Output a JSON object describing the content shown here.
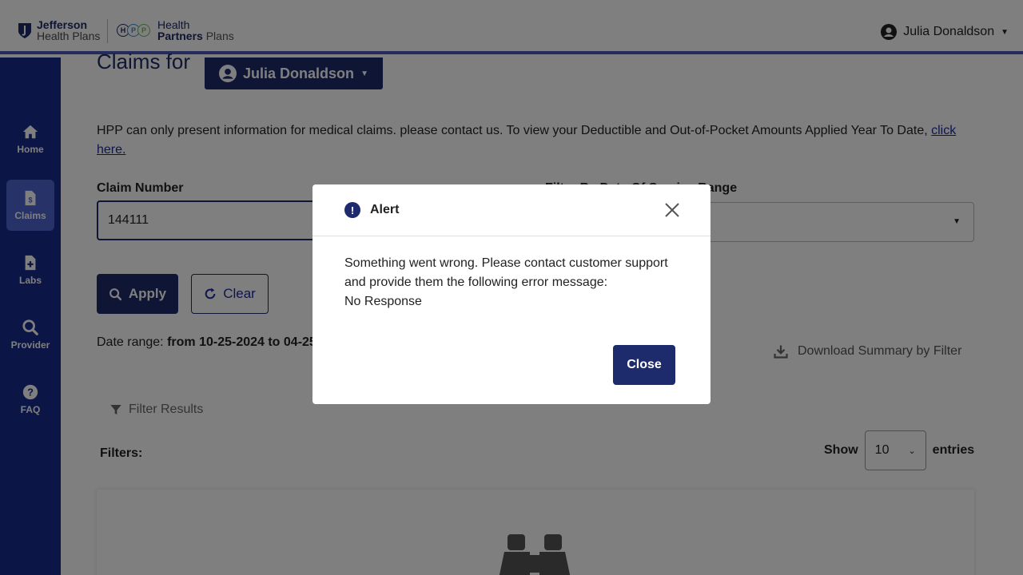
{
  "header": {
    "brand1_line1": "Jefferson",
    "brand1_line2": "Health Plans",
    "brand2_line1": "Health",
    "brand2_line2a": "Partners",
    "brand2_line2b": "Plans",
    "user_name": "Julia Donaldson"
  },
  "sidebar": {
    "items": [
      {
        "label": "Home",
        "icon": "home-icon"
      },
      {
        "label": "Claims",
        "icon": "claims-icon"
      },
      {
        "label": "Labs",
        "icon": "labs-icon"
      },
      {
        "label": "Provider",
        "icon": "search-icon"
      },
      {
        "label": "FAQ",
        "icon": "question-icon"
      }
    ]
  },
  "main": {
    "title": "Claims for",
    "member": "Julia Donaldson",
    "info_text": "HPP can only present information for medical claims. please contact us. To view your Deductible and Out-of-Pocket Amounts Applied Year To Date,",
    "info_link": "click here.",
    "claim_label": "Claim Number",
    "claim_value": "144111",
    "date_label": "Filter By Date Of Service Range",
    "apply_label": "Apply",
    "clear_label": "Clear",
    "date_range_prefix": "Date range:",
    "date_range_value": "from 10-25-2024 to 04-25",
    "download_label": "Download Summary by Filter",
    "filter_results_label": "Filter Results",
    "filters_label": "Filters:",
    "show_label": "Show",
    "entries_value": "10",
    "entries_label": "entries"
  },
  "modal": {
    "title": "Alert",
    "message": "Something went wrong. Please contact customer support and provide them the following error message:",
    "error": "No Response",
    "close_label": "Close"
  },
  "colors": {
    "navy": "#1d2a6b",
    "sidebar": "#162a8c",
    "sidebar_active": "#4f65d3"
  }
}
